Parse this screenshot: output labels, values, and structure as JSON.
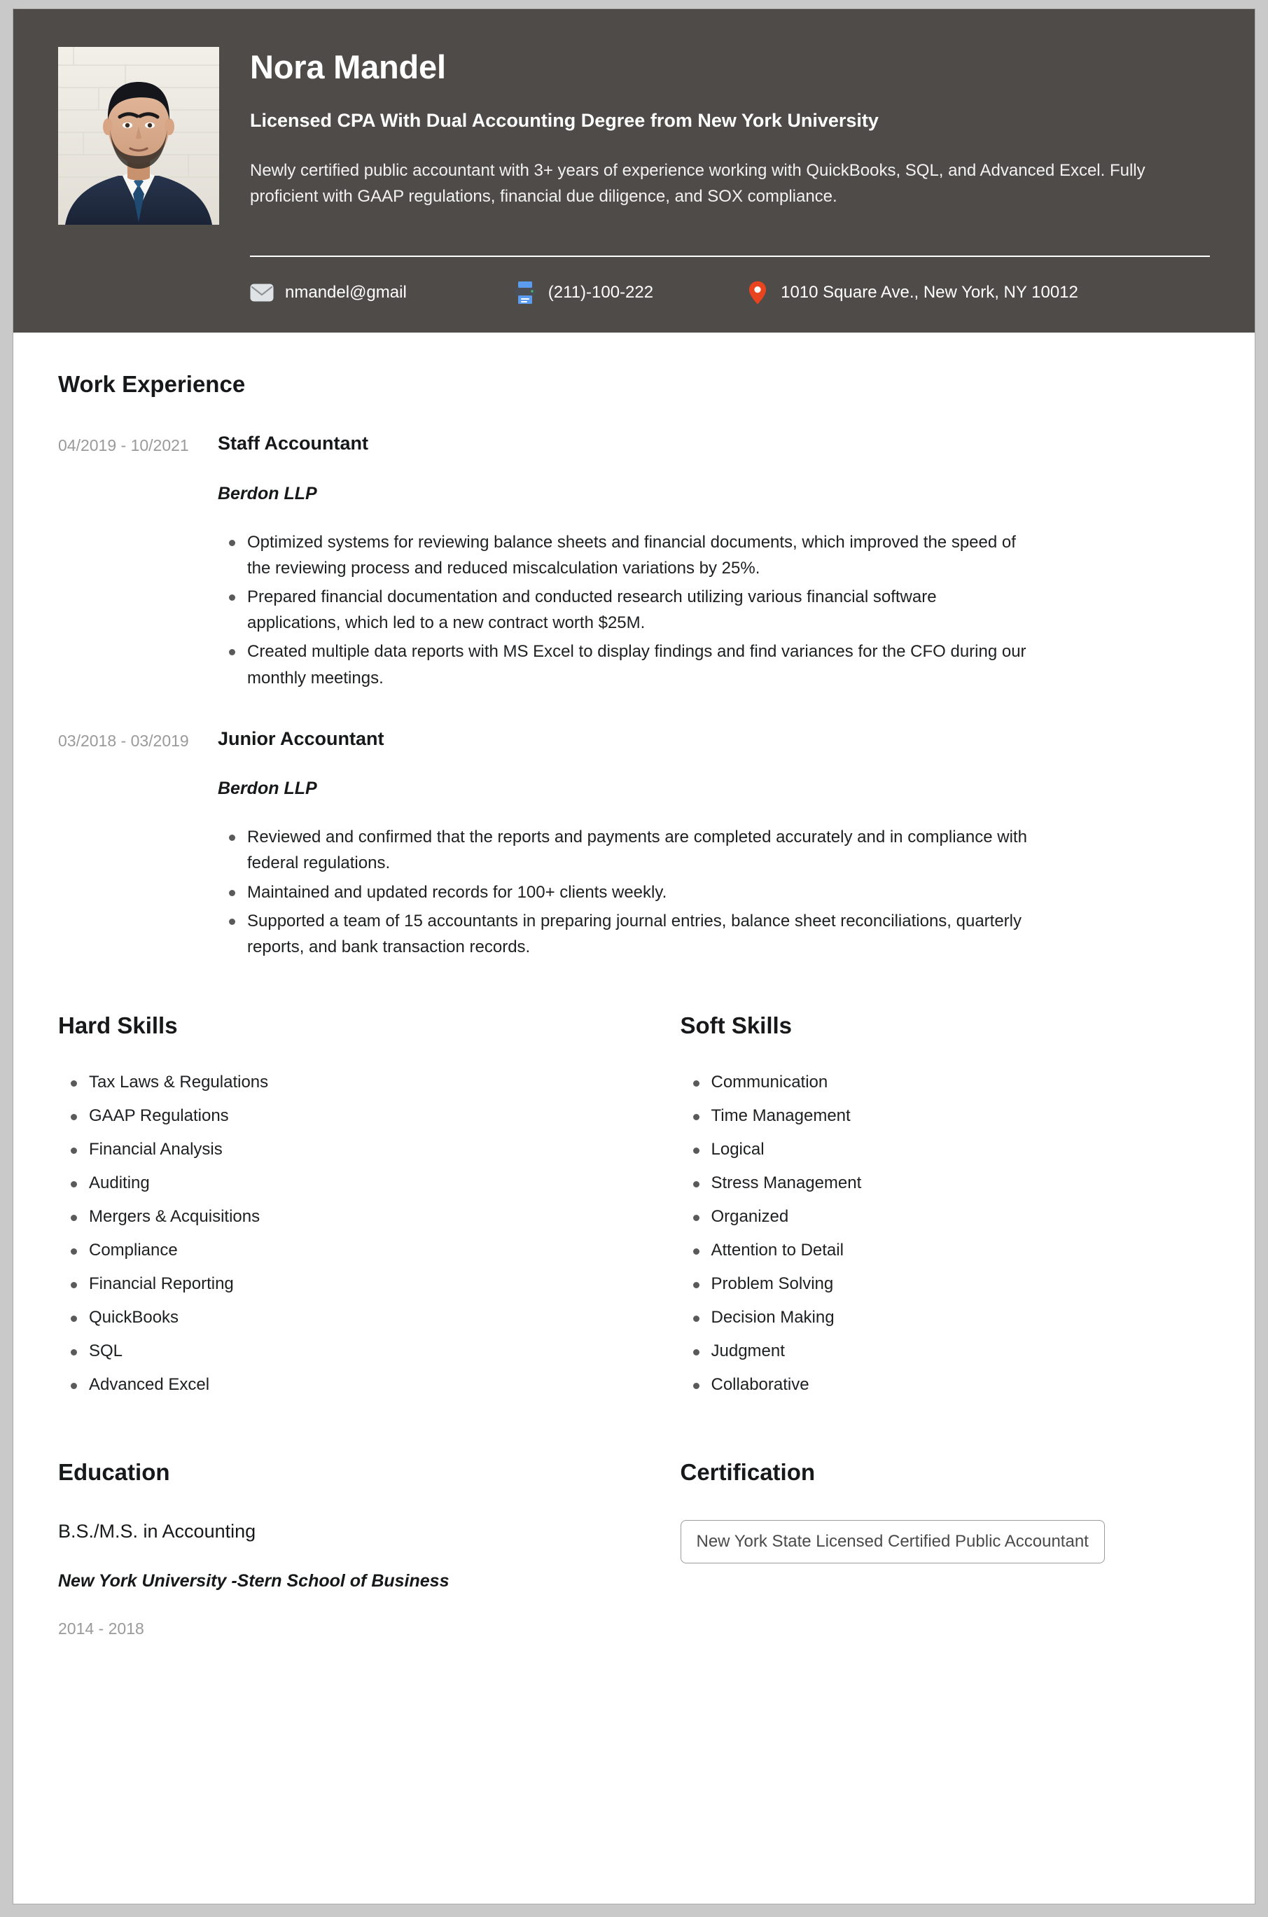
{
  "theme": {
    "page_background": "#c9c9c9",
    "card_background": "#ffffff",
    "header_background": "#4e4b49",
    "header_text": "#ffffff",
    "body_text": "#1d1f21",
    "muted_text": "#9a9a9a",
    "bullet_color": "#5a5a5a",
    "pin_color": "#e8441f",
    "fax_color": "#5b9bf0"
  },
  "header": {
    "name": "Nora Mandel",
    "headline": "Licensed CPA With Dual Accounting Degree from New York University",
    "summary": "Newly certified public accountant with 3+ years of experience working with QuickBooks, SQL, and Advanced Excel. Fully proficient with GAAP regulations, financial due diligence, and SOX compliance.",
    "photo_alt": "Headshot photo of applicant in dark suit and tie against a white brick wall",
    "contacts": [
      {
        "icon": "envelope-icon",
        "label": "nmandel@gmail"
      },
      {
        "icon": "fax-icon",
        "label": "(211)-100-222"
      },
      {
        "icon": "map-pin-icon",
        "label": "1010 Square Ave., New York, NY 10012"
      }
    ]
  },
  "work_experience": {
    "title": "Work Experience",
    "jobs": [
      {
        "dates": "04/2019 - 10/2021",
        "title": "Staff Accountant",
        "company": "Berdon LLP",
        "bullets": [
          "Optimized systems for reviewing balance sheets and financial documents, which improved the speed of the reviewing process and reduced miscalculation variations by 25%.",
          "Prepared financial documentation and conducted research utilizing various financial software applications, which led to a new contract worth $25M.",
          "Created multiple data reports with MS Excel to display findings and find variances for the CFO during our monthly meetings."
        ]
      },
      {
        "dates": "03/2018 - 03/2019",
        "title": "Junior Accountant",
        "company": "Berdon LLP",
        "bullets": [
          "Reviewed and confirmed that the reports and payments are completed accurately and in compliance with federal regulations.",
          "Maintained and updated records for 100+ clients weekly.",
          "Supported a team of 15 accountants in preparing journal entries, balance sheet reconciliations, quarterly reports, and bank transaction records."
        ]
      }
    ]
  },
  "hard_skills": {
    "title": "Hard Skills",
    "items": [
      "Tax Laws & Regulations",
      "GAAP Regulations",
      "Financial Analysis",
      "Auditing",
      "Mergers & Acquisitions",
      "Compliance",
      "Financial Reporting",
      "QuickBooks",
      "SQL",
      "Advanced Excel"
    ]
  },
  "soft_skills": {
    "title": "Soft Skills",
    "items": [
      "Communication",
      "Time Management",
      "Logical",
      "Stress Management",
      "Organized",
      "Attention to Detail",
      "Problem Solving",
      "Decision Making",
      "Judgment",
      "Collaborative"
    ]
  },
  "education": {
    "title": "Education",
    "degree": "B.S./M.S. in Accounting",
    "school": "New York University -Stern School of Business",
    "years": "2014 - 2018"
  },
  "certification": {
    "title": "Certification",
    "items": [
      "New York State Licensed Certified Public Accountant"
    ]
  }
}
